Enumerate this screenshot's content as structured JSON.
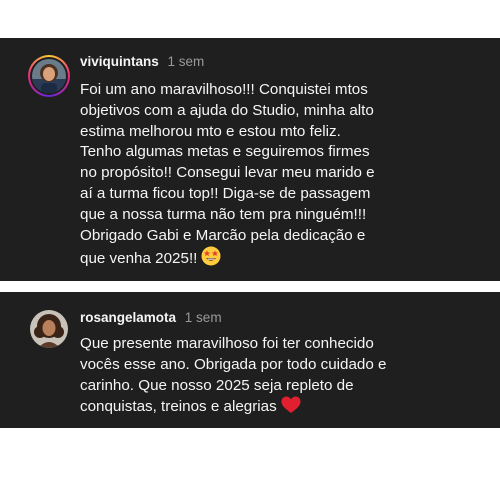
{
  "comments": [
    {
      "username": "viviquintans",
      "time": "1 sem",
      "text": "Foi um ano maravilhoso!!! Conquistei mtos\nobjetivos com a ajuda do Studio, minha alto\nestima melhorou mto e estou mto feliz.\nTenho algumas metas e seguiremos firmes\nno propósito!! Consegui levar meu marido e\naí a turma ficou top!! Diga-se de passagem\nque a nossa turma não tem pra ninguém!!!\nObrigado Gabi e Marcão pela dedicação e\nque venha 2025!!",
      "emoji": "star-struck-emoji"
    },
    {
      "username": "rosangelamota",
      "time": "1 sem",
      "text": "Que presente maravilhoso foi ter conhecido\nvocês esse ano. Obrigada por todo cuidado e\ncarinho. Que nosso 2025 seja repleto de\nconquistas, treinos e alegrias",
      "emoji": "red-heart-emoji"
    }
  ],
  "colors": {
    "card_background": "#1f1f1f",
    "text": "#f5f5f5",
    "muted": "#9a9a9a",
    "heart": "#e0202e",
    "emoji_face": "#ffcc3e"
  }
}
